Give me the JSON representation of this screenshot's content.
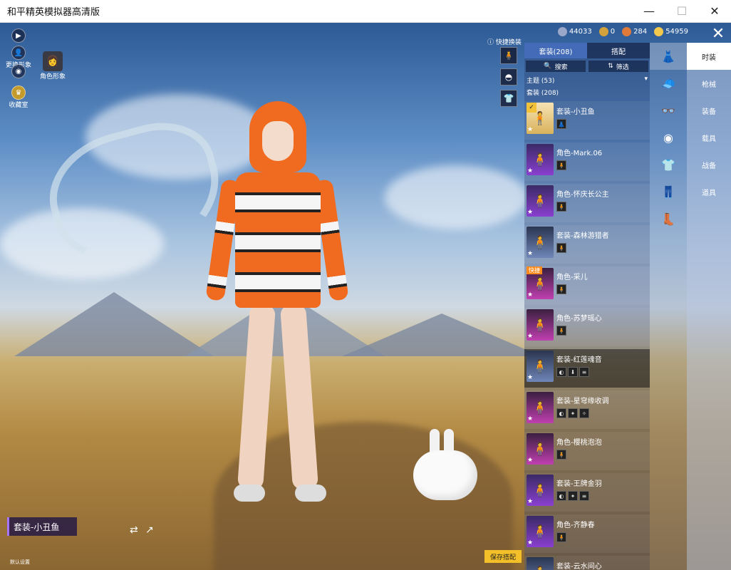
{
  "window": {
    "title": "和平精英模拟器高清版",
    "min": "—",
    "max": "☐",
    "close": "✕"
  },
  "topleft": {
    "play_icon": "▶",
    "change_label": "更换形象",
    "eye_icon": "◉",
    "collection_label": "收藏室",
    "avatar_label": "角色形象"
  },
  "currency": [
    {
      "value": "44033",
      "color": "#9aa7c8"
    },
    {
      "value": "0",
      "color": "#d4a23b"
    },
    {
      "value": "284",
      "color": "#e07a3a"
    },
    {
      "value": "54959",
      "color": "#f2c94c"
    }
  ],
  "quick_change": "快捷换装",
  "panel": {
    "tabs": [
      "套装(208)",
      "搭配"
    ],
    "search": "搜索",
    "filter": "筛选",
    "theme": "主题 (53)",
    "suits": "套装 (208)",
    "items": [
      {
        "name": "套装-小丑鱼",
        "style": "gold",
        "checked": true,
        "pieces": [
          "👗"
        ]
      },
      {
        "name": "角色-Mark.06",
        "style": "purple",
        "pieces": [
          "🧍"
        ]
      },
      {
        "name": "角色-怀庆长公主",
        "style": "purple",
        "pieces": [
          "🧍"
        ]
      },
      {
        "name": "套装-森林游猎者",
        "style": "blue",
        "pieces": [
          "🧍"
        ]
      },
      {
        "name": "角色-采儿",
        "style": "pink",
        "quick": "快捷",
        "pieces": [
          "🧍"
        ]
      },
      {
        "name": "角色-苏梦瑶心",
        "style": "pink",
        "pieces": [
          "🧍"
        ]
      },
      {
        "name": "套装-红莲魂音",
        "style": "blue",
        "selected": true,
        "pieces": [
          "◐",
          "⬇",
          "≡"
        ]
      },
      {
        "name": "套装-星穹缘收调",
        "style": "pink",
        "pieces": [
          "◐",
          "✦",
          "✧"
        ]
      },
      {
        "name": "角色-樱桃泡泡",
        "style": "pink",
        "pieces": [
          "🧍"
        ]
      },
      {
        "name": "套装-王牌金羽",
        "style": "purple",
        "pieces": [
          "◐",
          "✦",
          "≡"
        ]
      },
      {
        "name": "角色-齐静春",
        "style": "purple",
        "pieces": [
          "🧍"
        ]
      },
      {
        "name": "套装-云水间心",
        "style": "blue",
        "pieces": [
          "◐",
          "✦"
        ]
      }
    ]
  },
  "categories": [
    "时装",
    "枪械",
    "装备",
    "载具",
    "战备",
    "道具"
  ],
  "bottom": {
    "outfit": "套装-小丑鱼",
    "note": "默认设置",
    "save": "保存搭配"
  }
}
